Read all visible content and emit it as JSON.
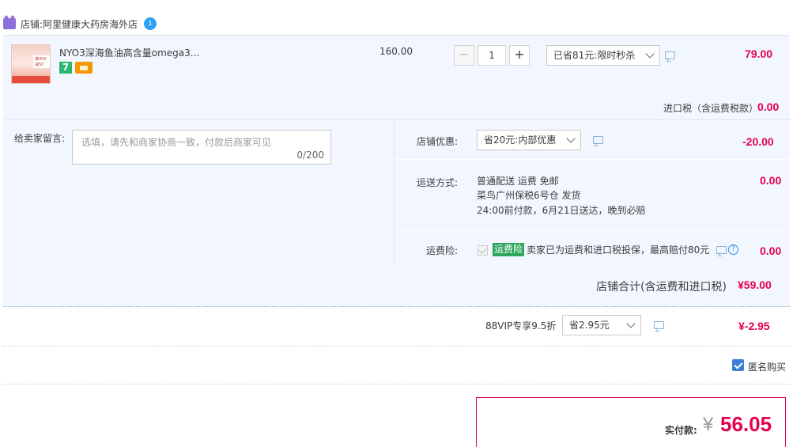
{
  "store": {
    "label": "店铺:",
    "name": "阿里健康大药房海外店",
    "ww_icon_text": "1"
  },
  "item": {
    "title": "NYO3深海鱼油高含量omega3...",
    "thumb_label": "满300减50",
    "badge_7": "7",
    "unit_price": "160.00",
    "quantity": "1",
    "qty_minus": "−",
    "qty_plus": "+",
    "promo_select": "已省81元:限时秒杀",
    "subtotal": "79.00"
  },
  "tax": {
    "label": "进口税（含运费税款）",
    "value": "0.00"
  },
  "memo": {
    "label": "给卖家留言:",
    "placeholder": "选填，请先和商家协商一致，付款后商家可见",
    "counter": "0/200"
  },
  "store_discount": {
    "label": "店铺优惠:",
    "select": "省20元:内部优惠",
    "value": "-20.00"
  },
  "shipping": {
    "label": "运送方式:",
    "line1": "普通配送 运费 免邮",
    "line2": "菜鸟广州保税6号仓   发货",
    "line3": "24:00前付款，6月21日送达，晚到必赔",
    "value": "0.00"
  },
  "insurance": {
    "label": "运费险:",
    "tag": "运费险",
    "text": "卖家已为运费和进口税投保，最高赔付80元",
    "help": "?",
    "value": "0.00"
  },
  "store_total": {
    "label": "店铺合计(含运费和进口税)",
    "value": "¥59.00"
  },
  "vip": {
    "label": "88VIP专享9.5折",
    "select": "省2.95元",
    "value": "¥-2.95"
  },
  "anonymous": {
    "label": "匿名购买",
    "checked": true
  },
  "payment": {
    "label": "实付款:",
    "currency": "¥",
    "amount": "56.05"
  },
  "colors": {
    "accent_red": "#e5004f",
    "panel_bg": "#f2f7ff",
    "checkbox_blue": "#3c7fd8",
    "insurance_green": "#2ea55a"
  }
}
